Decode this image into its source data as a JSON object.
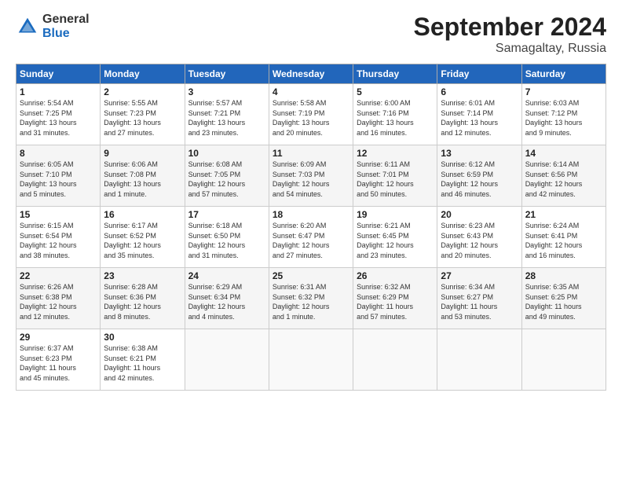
{
  "header": {
    "logo_general": "General",
    "logo_blue": "Blue",
    "month_title": "September 2024",
    "location": "Samagaltay, Russia"
  },
  "weekdays": [
    "Sunday",
    "Monday",
    "Tuesday",
    "Wednesday",
    "Thursday",
    "Friday",
    "Saturday"
  ],
  "weeks": [
    [
      {
        "day": "1",
        "info": "Sunrise: 5:54 AM\nSunset: 7:25 PM\nDaylight: 13 hours\nand 31 minutes."
      },
      {
        "day": "2",
        "info": "Sunrise: 5:55 AM\nSunset: 7:23 PM\nDaylight: 13 hours\nand 27 minutes."
      },
      {
        "day": "3",
        "info": "Sunrise: 5:57 AM\nSunset: 7:21 PM\nDaylight: 13 hours\nand 23 minutes."
      },
      {
        "day": "4",
        "info": "Sunrise: 5:58 AM\nSunset: 7:19 PM\nDaylight: 13 hours\nand 20 minutes."
      },
      {
        "day": "5",
        "info": "Sunrise: 6:00 AM\nSunset: 7:16 PM\nDaylight: 13 hours\nand 16 minutes."
      },
      {
        "day": "6",
        "info": "Sunrise: 6:01 AM\nSunset: 7:14 PM\nDaylight: 13 hours\nand 12 minutes."
      },
      {
        "day": "7",
        "info": "Sunrise: 6:03 AM\nSunset: 7:12 PM\nDaylight: 13 hours\nand 9 minutes."
      }
    ],
    [
      {
        "day": "8",
        "info": "Sunrise: 6:05 AM\nSunset: 7:10 PM\nDaylight: 13 hours\nand 5 minutes."
      },
      {
        "day": "9",
        "info": "Sunrise: 6:06 AM\nSunset: 7:08 PM\nDaylight: 13 hours\nand 1 minute."
      },
      {
        "day": "10",
        "info": "Sunrise: 6:08 AM\nSunset: 7:05 PM\nDaylight: 12 hours\nand 57 minutes."
      },
      {
        "day": "11",
        "info": "Sunrise: 6:09 AM\nSunset: 7:03 PM\nDaylight: 12 hours\nand 54 minutes."
      },
      {
        "day": "12",
        "info": "Sunrise: 6:11 AM\nSunset: 7:01 PM\nDaylight: 12 hours\nand 50 minutes."
      },
      {
        "day": "13",
        "info": "Sunrise: 6:12 AM\nSunset: 6:59 PM\nDaylight: 12 hours\nand 46 minutes."
      },
      {
        "day": "14",
        "info": "Sunrise: 6:14 AM\nSunset: 6:56 PM\nDaylight: 12 hours\nand 42 minutes."
      }
    ],
    [
      {
        "day": "15",
        "info": "Sunrise: 6:15 AM\nSunset: 6:54 PM\nDaylight: 12 hours\nand 38 minutes."
      },
      {
        "day": "16",
        "info": "Sunrise: 6:17 AM\nSunset: 6:52 PM\nDaylight: 12 hours\nand 35 minutes."
      },
      {
        "day": "17",
        "info": "Sunrise: 6:18 AM\nSunset: 6:50 PM\nDaylight: 12 hours\nand 31 minutes."
      },
      {
        "day": "18",
        "info": "Sunrise: 6:20 AM\nSunset: 6:47 PM\nDaylight: 12 hours\nand 27 minutes."
      },
      {
        "day": "19",
        "info": "Sunrise: 6:21 AM\nSunset: 6:45 PM\nDaylight: 12 hours\nand 23 minutes."
      },
      {
        "day": "20",
        "info": "Sunrise: 6:23 AM\nSunset: 6:43 PM\nDaylight: 12 hours\nand 20 minutes."
      },
      {
        "day": "21",
        "info": "Sunrise: 6:24 AM\nSunset: 6:41 PM\nDaylight: 12 hours\nand 16 minutes."
      }
    ],
    [
      {
        "day": "22",
        "info": "Sunrise: 6:26 AM\nSunset: 6:38 PM\nDaylight: 12 hours\nand 12 minutes."
      },
      {
        "day": "23",
        "info": "Sunrise: 6:28 AM\nSunset: 6:36 PM\nDaylight: 12 hours\nand 8 minutes."
      },
      {
        "day": "24",
        "info": "Sunrise: 6:29 AM\nSunset: 6:34 PM\nDaylight: 12 hours\nand 4 minutes."
      },
      {
        "day": "25",
        "info": "Sunrise: 6:31 AM\nSunset: 6:32 PM\nDaylight: 12 hours\nand 1 minute."
      },
      {
        "day": "26",
        "info": "Sunrise: 6:32 AM\nSunset: 6:29 PM\nDaylight: 11 hours\nand 57 minutes."
      },
      {
        "day": "27",
        "info": "Sunrise: 6:34 AM\nSunset: 6:27 PM\nDaylight: 11 hours\nand 53 minutes."
      },
      {
        "day": "28",
        "info": "Sunrise: 6:35 AM\nSunset: 6:25 PM\nDaylight: 11 hours\nand 49 minutes."
      }
    ],
    [
      {
        "day": "29",
        "info": "Sunrise: 6:37 AM\nSunset: 6:23 PM\nDaylight: 11 hours\nand 45 minutes."
      },
      {
        "day": "30",
        "info": "Sunrise: 6:38 AM\nSunset: 6:21 PM\nDaylight: 11 hours\nand 42 minutes."
      },
      {
        "day": "",
        "info": ""
      },
      {
        "day": "",
        "info": ""
      },
      {
        "day": "",
        "info": ""
      },
      {
        "day": "",
        "info": ""
      },
      {
        "day": "",
        "info": ""
      }
    ]
  ]
}
